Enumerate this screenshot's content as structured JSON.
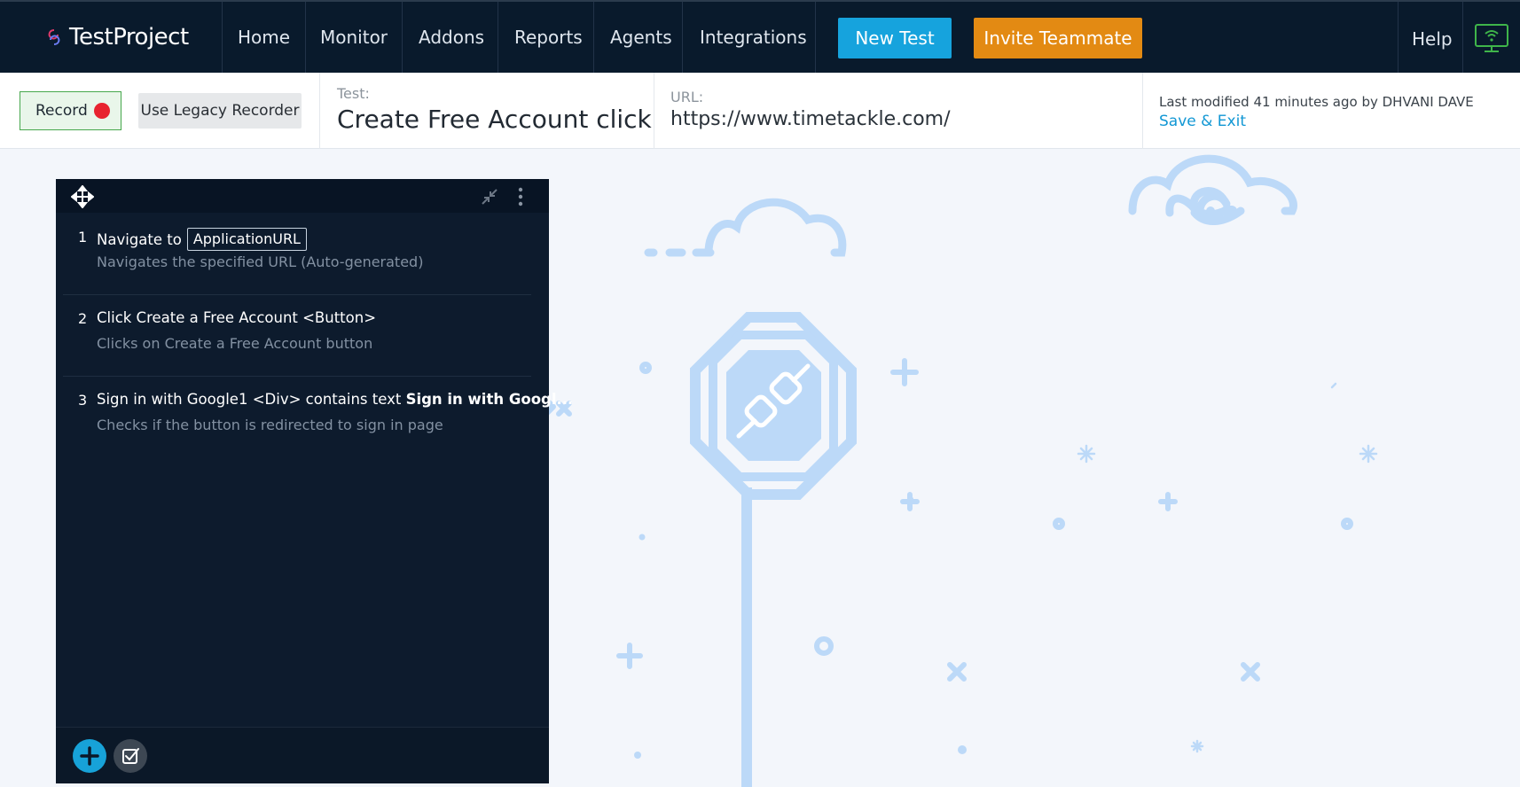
{
  "nav": {
    "logo": "TestProject",
    "items": [
      "Home",
      "Monitor",
      "Addons",
      "Reports",
      "Agents",
      "Integrations"
    ],
    "new_test": "New Test",
    "invite": "Invite Teammate",
    "help": "Help",
    "icons": {
      "monitor": "monitor-wifi-icon"
    }
  },
  "toolbar": {
    "record_label": "Record",
    "legacy_label": "Use Legacy Recorder",
    "test_label": "Test:",
    "test_name": "Create Free Account click",
    "url_label": "URL:",
    "url": "https://www.timetackle.com/",
    "last_modified": "Last modified 41 minutes ago by DHVANI DAVE",
    "save_exit": "Save & Exit"
  },
  "steps": [
    {
      "num": "1",
      "title": "Navigate to",
      "param": "ApplicationURL",
      "desc": "Navigates the specified URL (Auto-generated)"
    },
    {
      "num": "2",
      "title": "Click Create a Free Account <Button>",
      "desc": "Clicks on Create a Free Account button"
    },
    {
      "num": "3",
      "title": "Sign in with Google1 <Div> contains text",
      "title_bold": "Sign in with Googl...",
      "desc": "Checks if the button is redirected to sign in page"
    }
  ],
  "colors": {
    "nav_bg": "#091a2c",
    "new_test": "#16a3dd",
    "invite": "#e38a13",
    "record_dot": "#e8232f",
    "panel_bg": "#0d1b2d",
    "illustration": "#bcd9f8"
  }
}
